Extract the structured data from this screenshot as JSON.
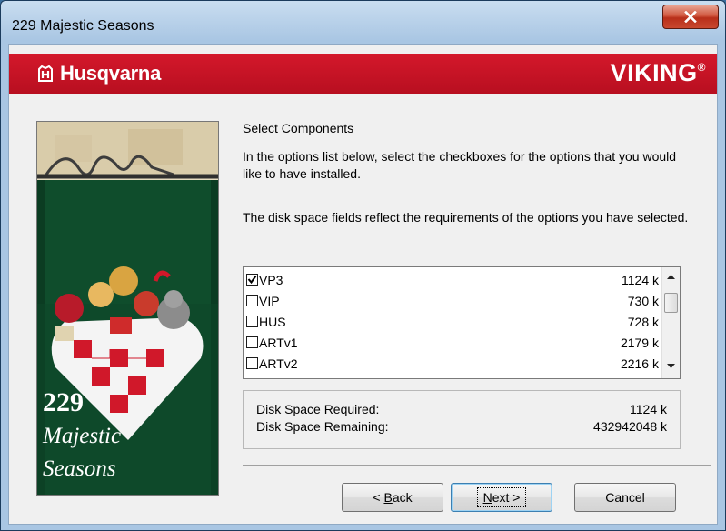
{
  "window": {
    "title": "229 Majestic Seasons"
  },
  "banner": {
    "brand_left": "Husqvarna",
    "brand_right": "VIKING",
    "brand_right_mark": "®",
    "color": "#c41224"
  },
  "artwork": {
    "number": "229",
    "line1": "Majestic",
    "line2": "Seasons"
  },
  "main": {
    "heading": "Select Components",
    "instructions_1": "In the options list below, select the checkboxes for the options that you would like to have installed.",
    "instructions_2": "The disk space fields reflect the requirements of the options you have selected."
  },
  "components": [
    {
      "name": "VP3",
      "size": "1124 k",
      "checked": true
    },
    {
      "name": "VIP",
      "size": "730 k",
      "checked": false
    },
    {
      "name": "HUS",
      "size": "728 k",
      "checked": false
    },
    {
      "name": "ARTv1",
      "size": "2179 k",
      "checked": false
    },
    {
      "name": "ARTv2",
      "size": "2216 k",
      "checked": false
    }
  ],
  "disk": {
    "required_label": "Disk Space Required:",
    "required_value": "1124 k",
    "remaining_label": "Disk Space Remaining:",
    "remaining_value": "432942048 k"
  },
  "buttons": {
    "back_prefix": "< ",
    "back_underlined": "B",
    "back_rest": "ack",
    "next_underlined": "N",
    "next_rest": "ext >",
    "cancel": "Cancel"
  }
}
